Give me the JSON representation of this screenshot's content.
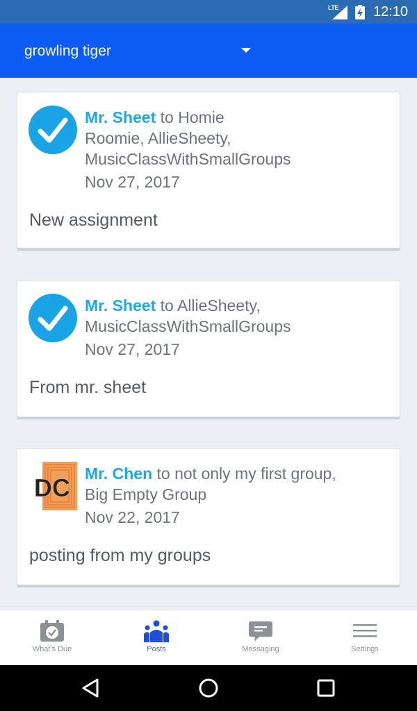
{
  "status_bar": {
    "network": "LTE",
    "time": "12:10"
  },
  "app_bar": {
    "title": "growling tiger"
  },
  "posts": [
    {
      "author": "Mr. Sheet",
      "audience_line1": " to Homie",
      "audience_line2": "Roomie, AllieSheety,",
      "audience_line3": "MusicClassWithSmallGroups",
      "date": "Nov 27, 2017",
      "body": "New assignment",
      "avatar": "checkmark-avatar"
    },
    {
      "author": "Mr. Sheet",
      "audience_line1": " to AllieSheety,",
      "audience_line2": "MusicClassWithSmallGroups",
      "date": "Nov 27, 2017",
      "body": "From mr. sheet",
      "avatar": "checkmark-avatar"
    },
    {
      "author": "Mr. Chen",
      "audience_line1": " to not only my first group,",
      "audience_line2": "Big Empty Group",
      "date": "Nov 22, 2017",
      "body": "posting from my groups",
      "avatar": "dc-logo-avatar",
      "avatar_text": "DC"
    }
  ],
  "bottom_nav": {
    "items": [
      {
        "label": "What's Due",
        "icon": "calendar-check-icon"
      },
      {
        "label": "Posts",
        "icon": "people-icon",
        "active": true
      },
      {
        "label": "Messaging",
        "icon": "chat-bubble-icon"
      },
      {
        "label": "Settings",
        "icon": "hamburger-menu-icon"
      }
    ]
  },
  "colors": {
    "app_bar": "#0d5cf5",
    "status_bar": "#2a6cb4",
    "author_link": "#19aaea",
    "active_nav": "#1f4fd6"
  }
}
